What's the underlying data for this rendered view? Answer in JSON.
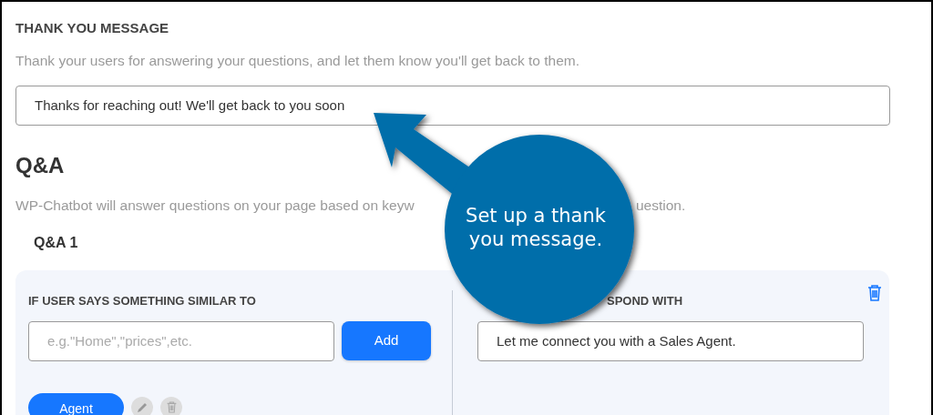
{
  "thank_you": {
    "title": "THANK YOU MESSAGE",
    "description": "Thank your users for answering your questions, and let them know you'll get back to them.",
    "value": "Thanks for reaching out! We'll get back to you soon"
  },
  "qa": {
    "title": "Q&A",
    "description_parts": [
      "WP-Chatbot will answer questions on your page based on keyw",
      "uestion."
    ],
    "items": [
      {
        "title": "Q&A 1",
        "trigger_heading": "IF USER SAYS SOMETHING SIMILAR TO",
        "trigger_placeholder": "e.g.\"Home\",\"prices\",etc.",
        "add_button": "Add",
        "keywords": [
          "Agent"
        ],
        "response_heading": "SPOND WITH",
        "response_value": "Let me connect you with a Sales Agent."
      }
    ]
  },
  "callout": {
    "text": "Set up a thank you message."
  }
}
